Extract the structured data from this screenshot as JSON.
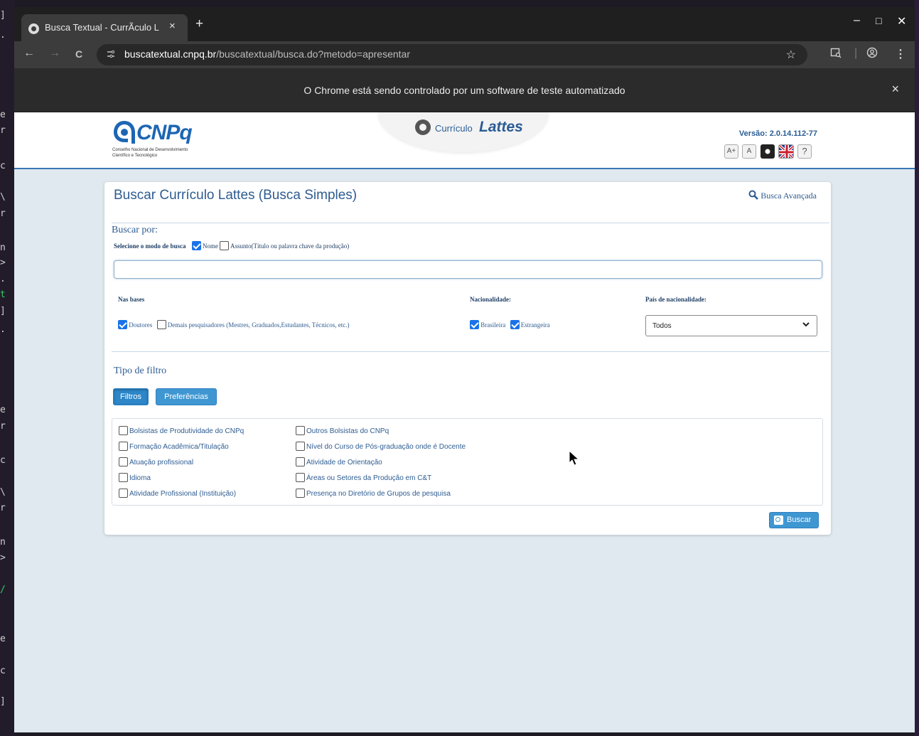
{
  "terminal_chars": [
    "]",
    ".",
    "e",
    "r",
    "c",
    "\\",
    "r",
    "n",
    ">",
    ".",
    "t",
    "]",
    ".",
    "e",
    "r",
    "c",
    "\\",
    "r",
    "n",
    ">",
    "/",
    "e",
    "c",
    "]"
  ],
  "browser": {
    "tab_title": "Busca Textual - CurrÃculo L",
    "tab_close": "×",
    "new_tab": "+",
    "win_minimize": "–",
    "win_maximize": "□",
    "win_close": "✕",
    "back": "←",
    "forward": "→",
    "reload": "C",
    "url_host": "buscatextual.cnpq.br",
    "url_path": "/buscatextual/busca.do?metodo=apresentar",
    "star": "☆",
    "menu": "⋮",
    "infobar_message": "O Chrome está sendo controlado por um software de teste automatizado",
    "infobar_close": "×"
  },
  "header": {
    "cnpq_word": "CNPq",
    "cnpq_sub1": "Conselho Nacional de Desenvolvimento",
    "cnpq_sub2": "Científico e Tecnológico",
    "curriculo": "Currículo",
    "lattes": "Lattes",
    "versao": "Versão: 2.0.14.112-77",
    "tool_a_plus": "A+",
    "tool_a": "A",
    "tool_help": "?"
  },
  "form": {
    "title": "Buscar Currículo Lattes (Busca Simples)",
    "advanced_link": "Busca Avançada",
    "buscar_por": "Buscar por:",
    "modo_label": "Selecione o modo de busca",
    "modo_nome": "Nome",
    "modo_assunto": "Assunto(Título ou palavra chave da produção)",
    "nome_checked": true,
    "search_value": "",
    "bases_label": "Nas bases",
    "base_doutores": "Doutores",
    "base_demais": "Demais pesquisadores (Mestres, Graduados,Estudantes, Técnicos, etc.)",
    "nacionalidade_label": "Nacionalidade:",
    "nac_brasileira": "Brasileira",
    "nac_estrangeira": "Estrangeira",
    "pais_label": "País de nacionalidade:",
    "pais_value": "Todos",
    "tipo_filtro": "Tipo de filtro",
    "btn_filtros": "Filtros",
    "btn_preferencias": "Preferências",
    "filters": [
      "Bolsistas de Produtividade do CNPq",
      "Formação Acadêmica/Titulação",
      "Atuação profissional",
      "Idioma",
      "Atividade Profissional (Instituição)",
      "Outros Bolsistas do CNPq",
      "Nível do Curso de Pós-graduação onde é Docente",
      "Atividade de Orientação",
      "Áreas ou Setores da Produção em C&T",
      "Presença no Diretório de Grupos de pesquisa"
    ],
    "buscar_button": "Buscar"
  },
  "colors": {
    "brand_blue": "#2e5c91",
    "button_blue": "#3f97d2",
    "page_bg": "#dfe9ef"
  }
}
